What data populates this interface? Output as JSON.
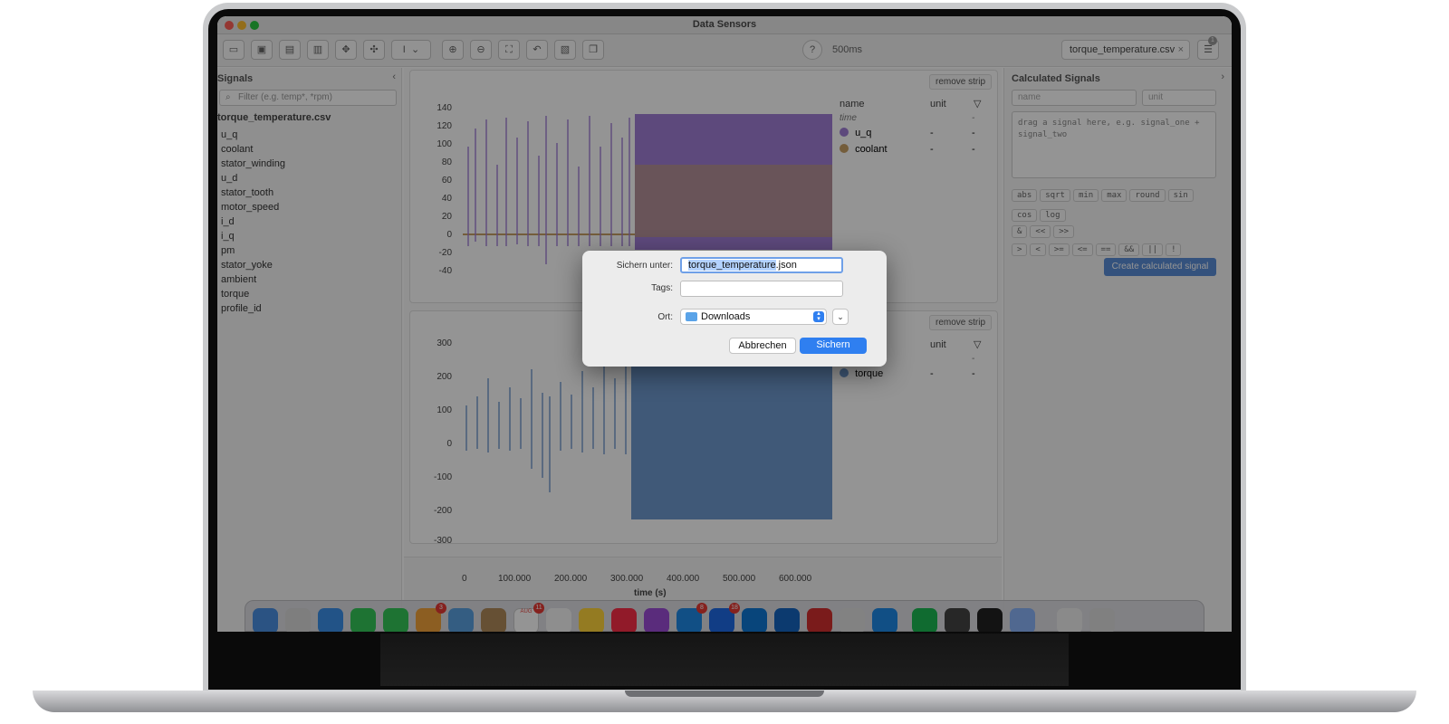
{
  "window": {
    "title": "Data Sensors"
  },
  "toolbar": {
    "interval": "500ms",
    "file_chip": "torque_temperature.csv",
    "close_glyph": "×",
    "help_glyph": "?",
    "badge": "1",
    "icons": [
      "open-folder-icon",
      "save-icon",
      "document-icon",
      "film-icon",
      "move-icon",
      "shrink-icon",
      "text-cursor-icon",
      "chevron-down-icon",
      "zoom-in-icon",
      "zoom-out-icon",
      "fullscreen-icon",
      "reset-icon",
      "image-icon",
      "copy-icon"
    ]
  },
  "sidebar": {
    "title": "Signals",
    "collapse_glyph": "‹",
    "filter_placeholder": "Filter (e.g. temp*, *rpm)",
    "file_name": "torque_temperature.csv",
    "items": [
      "u_q",
      "coolant",
      "stator_winding",
      "u_d",
      "stator_tooth",
      "motor_speed",
      "i_d",
      "i_q",
      "pm",
      "stator_yoke",
      "ambient",
      "torque",
      "profile_id"
    ]
  },
  "strips": [
    {
      "remove_label": "remove strip",
      "columns": {
        "name": "name",
        "unit": "unit"
      },
      "rows": [
        {
          "name": "time",
          "unit": "",
          "extra": "-"
        },
        {
          "name": "u_q",
          "unit": "-",
          "extra": "-",
          "color": "#a07fd6"
        },
        {
          "name": "coolant",
          "unit": "-",
          "extra": "-",
          "color": "#c9a067"
        }
      ],
      "y_ticks": [
        "140",
        "120",
        "100",
        "80",
        "60",
        "40",
        "20",
        "0",
        "-20",
        "-40"
      ]
    },
    {
      "remove_label": "remove strip",
      "columns": {
        "unit": "unit"
      },
      "rows": [
        {
          "name": "",
          "unit": "",
          "extra": "-"
        },
        {
          "name": "torque",
          "unit": "-",
          "extra": "-",
          "color": "#6f99cf"
        }
      ],
      "y_ticks": [
        "300",
        "200",
        "100",
        "0",
        "-100",
        "-200",
        "-300"
      ]
    }
  ],
  "x_axis": {
    "ticks": [
      "0",
      "100.000",
      "200.000",
      "300.000",
      "400.000",
      "500.000",
      "600.000"
    ],
    "label": "time (s)"
  },
  "calculated": {
    "title": "Calculated Signals",
    "collapse_glyph": "›",
    "name_placeholder": "name",
    "unit_placeholder": "unit",
    "expression_placeholder": "drag a signal here, e.g. signal_one + signal_two",
    "functions": [
      "abs",
      "sqrt",
      "min",
      "max",
      "round",
      "sin",
      "cos",
      "log"
    ],
    "operators_a": [
      "&",
      "<<",
      ">>"
    ],
    "operators_b": [
      ">",
      "<",
      ">=",
      "<=",
      "==",
      "&&",
      "||",
      "!"
    ],
    "create_label": "Create calculated signal"
  },
  "dock": {
    "badges": [
      {
        "label": "3"
      },
      {
        "label": "11"
      },
      {
        "label": "8"
      },
      {
        "label": "18"
      }
    ],
    "calendar_month": "AUG"
  },
  "dialog": {
    "save_as_label": "Sichern unter:",
    "filename_base": "torque_temperature",
    "filename_ext": ".json",
    "tags_label": "Tags:",
    "location_label": "Ort:",
    "location_value": "Downloads",
    "cancel_label": "Abbrechen",
    "save_label": "Sichern",
    "accent": "#2f7ff0"
  }
}
